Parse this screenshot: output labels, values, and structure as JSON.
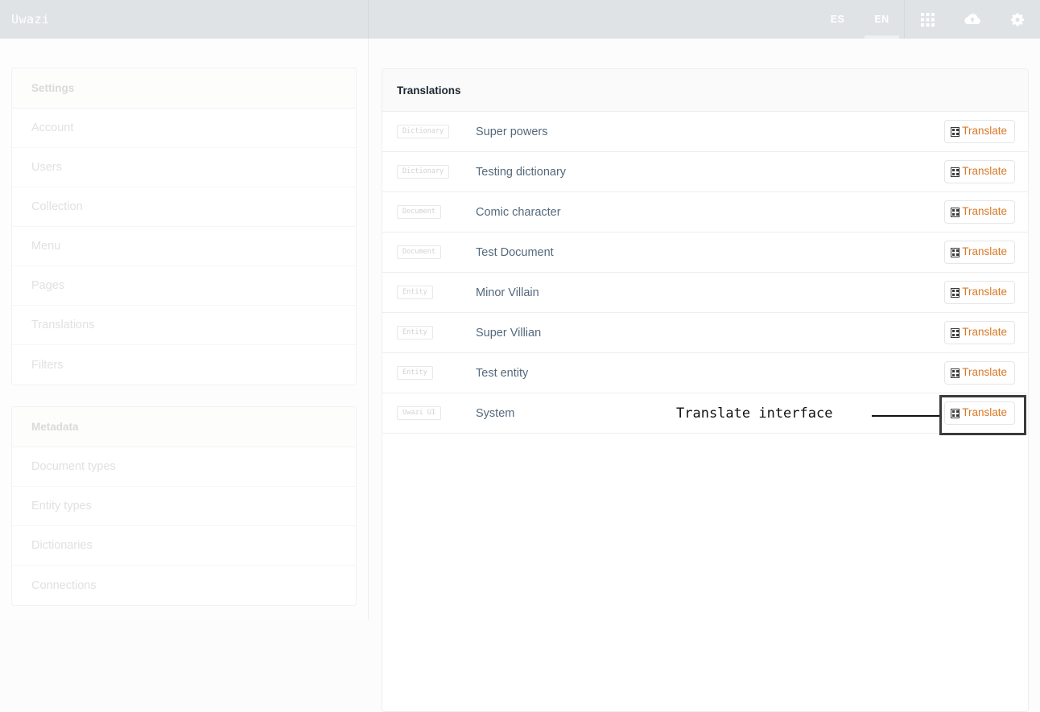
{
  "topbar": {
    "brand": "Uwazi",
    "languages": [
      {
        "code": "ES",
        "active": false
      },
      {
        "code": "EN",
        "active": true
      }
    ],
    "icons": [
      {
        "name": "apps-grid-icon",
        "title": "Apps"
      },
      {
        "name": "cloud-upload-icon",
        "title": "Upload"
      },
      {
        "name": "gear-icon",
        "title": "Settings"
      }
    ],
    "background": "#dfe3e6",
    "text_color": "#ffffff"
  },
  "sidebar": {
    "groups": [
      {
        "header": "Settings",
        "items": [
          {
            "label": "Account"
          },
          {
            "label": "Users"
          },
          {
            "label": "Collection"
          },
          {
            "label": "Menu"
          },
          {
            "label": "Pages"
          },
          {
            "label": "Translations"
          },
          {
            "label": "Filters"
          }
        ]
      },
      {
        "header": "Metadata",
        "items": [
          {
            "label": "Document types"
          },
          {
            "label": "Entity types"
          },
          {
            "label": "Dictionaries"
          },
          {
            "label": "Connections"
          }
        ]
      }
    ]
  },
  "main": {
    "title": "Translations",
    "action_label": "Translate",
    "rows": [
      {
        "badge": "Dictionary",
        "label": "Super powers",
        "action": "Translate",
        "highlighted": false
      },
      {
        "badge": "Dictionary",
        "label": "Testing dictionary",
        "action": "Translate",
        "highlighted": false
      },
      {
        "badge": "Document",
        "label": "Comic character",
        "action": "Translate",
        "highlighted": false
      },
      {
        "badge": "Document",
        "label": "Test Document",
        "action": "Translate",
        "highlighted": false
      },
      {
        "badge": "Entity",
        "label": "Minor Villain",
        "action": "Translate",
        "highlighted": false
      },
      {
        "badge": "Entity",
        "label": "Super Villian",
        "action": "Translate",
        "highlighted": false
      },
      {
        "badge": "Entity",
        "label": "Test entity",
        "action": "Translate",
        "highlighted": false
      },
      {
        "badge": "Uwazi UI",
        "label": "System",
        "action": "Translate",
        "highlighted": true
      }
    ]
  },
  "annotation": {
    "text": "Translate interface",
    "color": "#111111"
  },
  "colors": {
    "accent_orange": "#d97826",
    "topbar_bg": "#dfe3e6",
    "row_label": "#55697c",
    "muted_text": "#e0e1e3",
    "page_bg": "#fcfcfd"
  }
}
